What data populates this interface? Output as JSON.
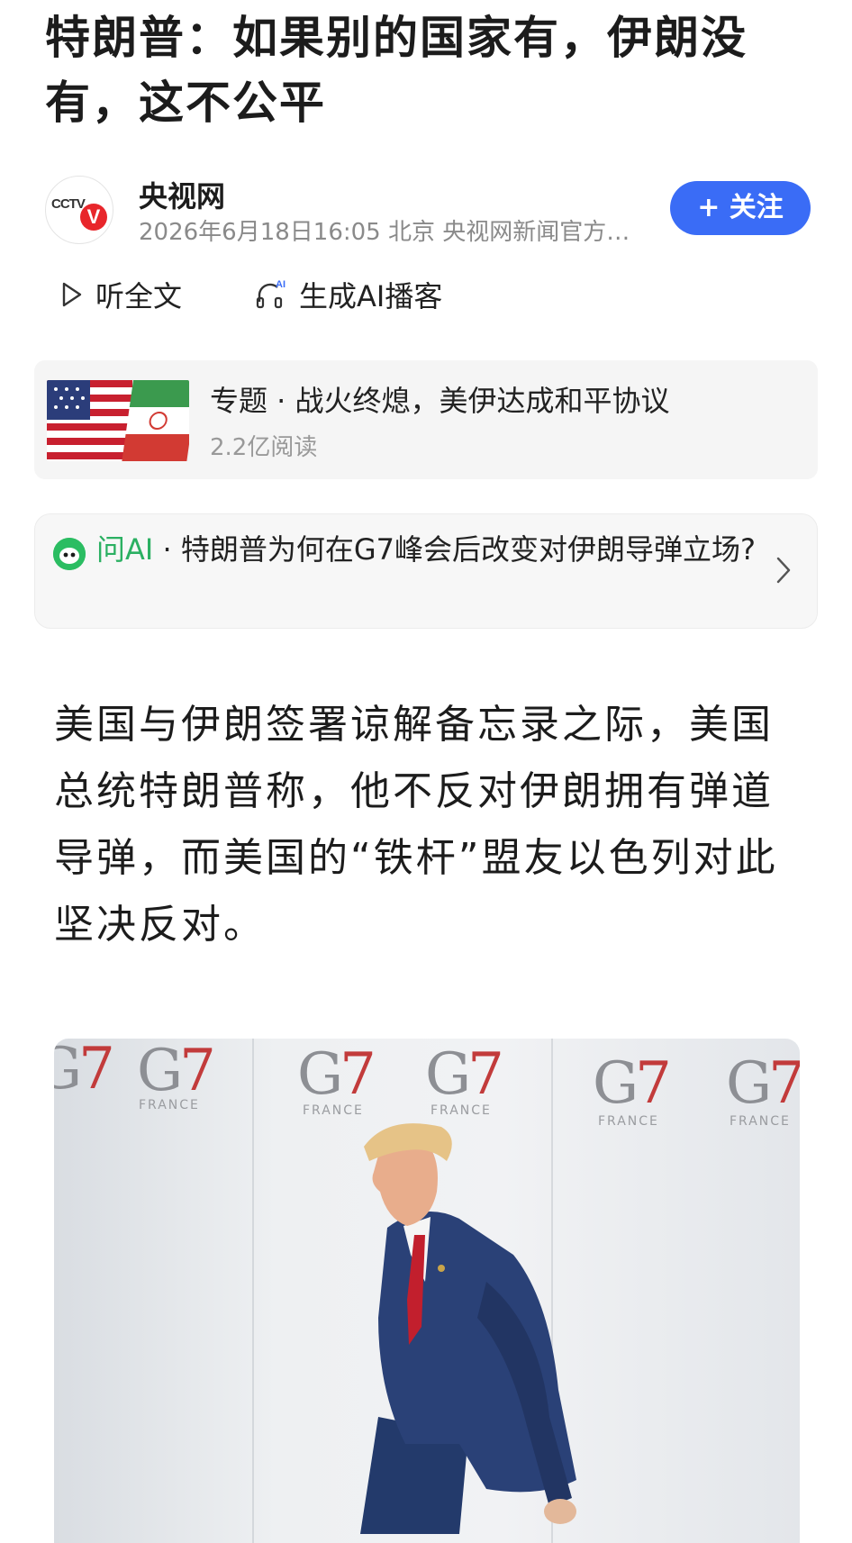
{
  "article": {
    "title": "特朗普：如果别的国家有，伊朗没有，这不公平"
  },
  "author": {
    "avatar_logo_text": "CCTV",
    "avatar_badge": "V",
    "name": "央视网",
    "meta": "2026年6月18日16:05 北京 央视网新闻官方…",
    "follow_label": "+ 关注"
  },
  "actions": {
    "listen_label": "听全文",
    "podcast_label": "生成AI播客",
    "podcast_badge": "AI"
  },
  "topic": {
    "title": "专题 · 战火终熄，美伊达成和平协议",
    "reads": "2.2亿阅读"
  },
  "ask_ai": {
    "label": "问AI",
    "separator": " · ",
    "question": "特朗普为何在G7峰会后改变对伊朗导弹立场?"
  },
  "body": {
    "paragraph": "美国与伊朗签署谅解备忘录之际，美国总统特朗普称，他不反对伊朗拥有弹道导弹，而美国的“铁杆”盟友以色列对此坚决反对。"
  },
  "photo": {
    "backdrop_logos": [
      {
        "g": "G",
        "seven": "7",
        "sub": "FRANCE"
      },
      {
        "g": "G",
        "seven": "7",
        "sub": "FRANCE"
      },
      {
        "g": "G",
        "seven": "7",
        "sub": "FRANCE"
      },
      {
        "g": "G",
        "seven": "7",
        "sub": "FRANCE"
      },
      {
        "g": "G",
        "seven": "7",
        "sub": "FRANCE"
      },
      {
        "g": "G",
        "seven": "7",
        "sub": "FRANCE"
      }
    ]
  },
  "colors": {
    "accent_blue": "#3a6cf6",
    "ai_green": "#2bb062",
    "cctv_red": "#e8262b"
  },
  "icons": {
    "listen": "play-outline-icon",
    "podcast": "headphones-ai-icon",
    "chevron": "chevron-right-icon",
    "ai": "ai-assistant-icon"
  }
}
